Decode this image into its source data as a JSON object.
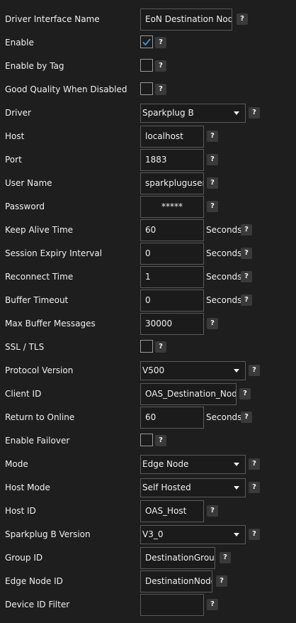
{
  "help_glyph": "?",
  "colors": {
    "background": "#1e1e1e",
    "checkmark": "#3d8fd1",
    "border": "#5a5a5a"
  },
  "fields": {
    "driver_interface_name": {
      "label": "Driver Interface Name",
      "value": "EoN Destination Node"
    },
    "enable": {
      "label": "Enable",
      "checked": true
    },
    "enable_by_tag": {
      "label": "Enable by Tag",
      "checked": false
    },
    "good_quality_when_disabled": {
      "label": "Good Quality When Disabled",
      "checked": false
    },
    "driver": {
      "label": "Driver",
      "value": "Sparkplug B"
    },
    "host": {
      "label": "Host",
      "value": "localhost"
    },
    "port": {
      "label": "Port",
      "value": "1883"
    },
    "user_name": {
      "label": "User Name",
      "value": "sparkpluguser"
    },
    "password": {
      "label": "Password",
      "value": "*****"
    },
    "keep_alive_time": {
      "label": "Keep Alive Time",
      "value": "60",
      "unit": "Seconds"
    },
    "session_expiry_interval": {
      "label": "Session Expiry Interval",
      "value": "0",
      "unit": "Seconds"
    },
    "reconnect_time": {
      "label": "Reconnect Time",
      "value": "1",
      "unit": "Seconds"
    },
    "buffer_timeout": {
      "label": "Buffer Timeout",
      "value": "0",
      "unit": "Seconds"
    },
    "max_buffer_messages": {
      "label": "Max Buffer Messages",
      "value": "30000"
    },
    "ssl_tls": {
      "label": "SSL / TLS",
      "checked": false
    },
    "protocol_version": {
      "label": "Protocol Version",
      "value": "V500"
    },
    "client_id": {
      "label": "Client ID",
      "value": "OAS_Destination_Node"
    },
    "return_to_online": {
      "label": "Return to Online",
      "value": "60",
      "unit": "Seconds"
    },
    "enable_failover": {
      "label": "Enable Failover",
      "checked": false
    },
    "mode": {
      "label": "Mode",
      "value": "Edge Node"
    },
    "host_mode": {
      "label": "Host Mode",
      "value": "Self Hosted"
    },
    "host_id": {
      "label": "Host ID",
      "value": "OAS_Host"
    },
    "sparkplug_b_version": {
      "label": "Sparkplug B Version",
      "value": "V3_0"
    },
    "group_id": {
      "label": "Group ID",
      "value": "DestinationGroup"
    },
    "edge_node_id": {
      "label": "Edge Node ID",
      "value": "DestinationNode"
    },
    "device_id_filter": {
      "label": "Device ID Filter",
      "value": ""
    }
  }
}
